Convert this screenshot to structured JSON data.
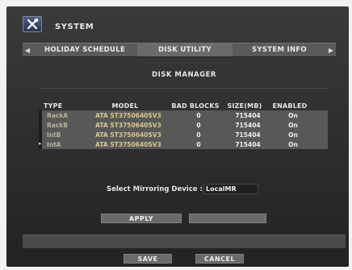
{
  "window": {
    "title": "SYSTEM"
  },
  "tabs": [
    {
      "label": "HOLIDAY SCHEDULE"
    },
    {
      "label": "DISK UTILITY"
    },
    {
      "label": "SYSTEM INFO"
    }
  ],
  "panel": {
    "title": "DISK MANAGER"
  },
  "table": {
    "columns": [
      "TYPE",
      "MODEL",
      "BAD BLOCKS",
      "SIZE(MB)",
      "ENABLED"
    ],
    "rows": [
      {
        "type": "RackA",
        "model": "ATA ST3750640SV3",
        "bad_blocks": "0",
        "size": "715404",
        "enabled": "On"
      },
      {
        "type": "RackB",
        "model": "ATA ST3750640SV3",
        "bad_blocks": "0",
        "size": "715404",
        "enabled": "On"
      },
      {
        "type": "IntB",
        "model": "ATA ST3750640SV3",
        "bad_blocks": "0",
        "size": "715404",
        "enabled": "On"
      },
      {
        "type": "IntA",
        "model": "ATA ST3750640SV3",
        "bad_blocks": "0",
        "size": "715404",
        "enabled": "On"
      }
    ],
    "current_row_marker": "•"
  },
  "mirroring": {
    "label": "Select Mirroring Device :",
    "value": "LocalMR"
  },
  "buttons": {
    "apply": "APPLY",
    "blank": "",
    "save": "SAVE",
    "cancel": "CANCEL"
  },
  "icons": {
    "title": "wrench-screwdriver-icon",
    "tab_left": "left-arrow-icon",
    "tab_right": "right-arrow-icon"
  },
  "colors": {
    "background": "#2d2d2d",
    "model_text": "#d6c78a",
    "type_text": "#b9b39a"
  }
}
